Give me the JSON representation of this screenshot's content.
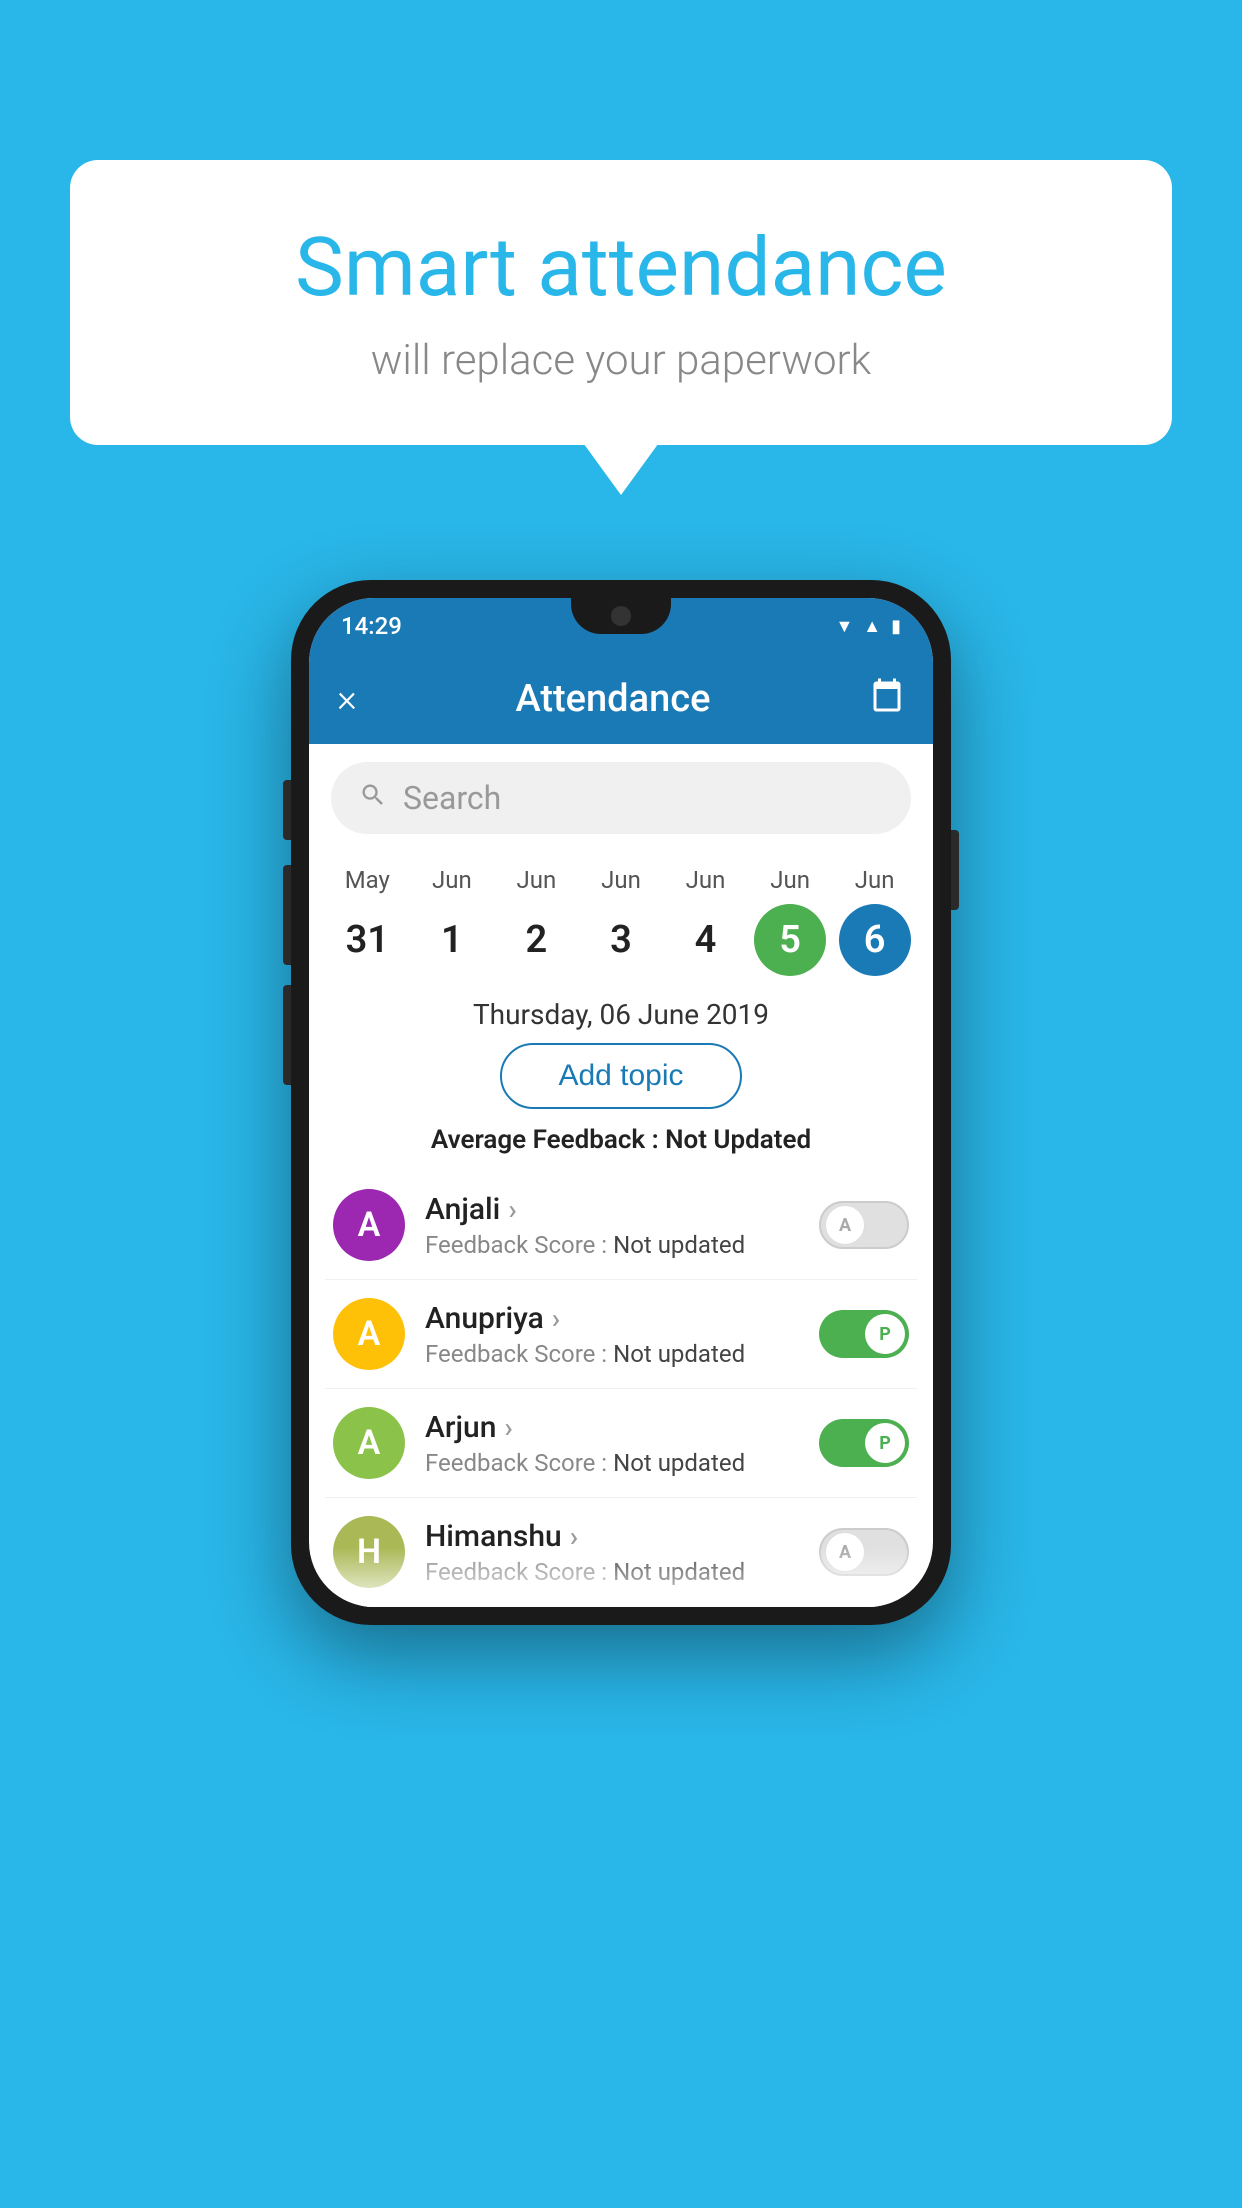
{
  "background_color": "#29b6e8",
  "speech_bubble": {
    "title": "Smart attendance",
    "subtitle": "will replace your paperwork"
  },
  "phone": {
    "status_bar": {
      "time": "14:29",
      "icons": [
        "wifi",
        "signal",
        "battery"
      ]
    },
    "header": {
      "close_label": "×",
      "title": "Attendance",
      "calendar_icon": "calendar"
    },
    "search": {
      "placeholder": "Search"
    },
    "calendar": {
      "days": [
        {
          "month": "May",
          "date": "31",
          "state": "normal"
        },
        {
          "month": "Jun",
          "date": "1",
          "state": "normal"
        },
        {
          "month": "Jun",
          "date": "2",
          "state": "normal"
        },
        {
          "month": "Jun",
          "date": "3",
          "state": "normal"
        },
        {
          "month": "Jun",
          "date": "4",
          "state": "normal"
        },
        {
          "month": "Jun",
          "date": "5",
          "state": "today"
        },
        {
          "month": "Jun",
          "date": "6",
          "state": "selected"
        }
      ]
    },
    "selected_date": "Thursday, 06 June 2019",
    "add_topic_label": "Add topic",
    "avg_feedback_label": "Average Feedback : ",
    "avg_feedback_value": "Not Updated",
    "students": [
      {
        "name": "Anjali",
        "avatar_letter": "A",
        "avatar_color": "#9c27b0",
        "feedback_label": "Feedback Score : ",
        "feedback_value": "Not updated",
        "attendance": "absent",
        "toggle_letter": "A"
      },
      {
        "name": "Anupriya",
        "avatar_letter": "A",
        "avatar_color": "#ffc107",
        "feedback_label": "Feedback Score : ",
        "feedback_value": "Not updated",
        "attendance": "present",
        "toggle_letter": "P"
      },
      {
        "name": "Arjun",
        "avatar_letter": "A",
        "avatar_color": "#8bc34a",
        "feedback_label": "Feedback Score : ",
        "feedback_value": "Not updated",
        "attendance": "present",
        "toggle_letter": "P"
      },
      {
        "name": "Himanshu",
        "avatar_letter": "H",
        "avatar_color": "#aab855",
        "feedback_label": "Feedback Score : ",
        "feedback_value": "Not updated",
        "attendance": "absent",
        "toggle_letter": "A"
      }
    ]
  }
}
